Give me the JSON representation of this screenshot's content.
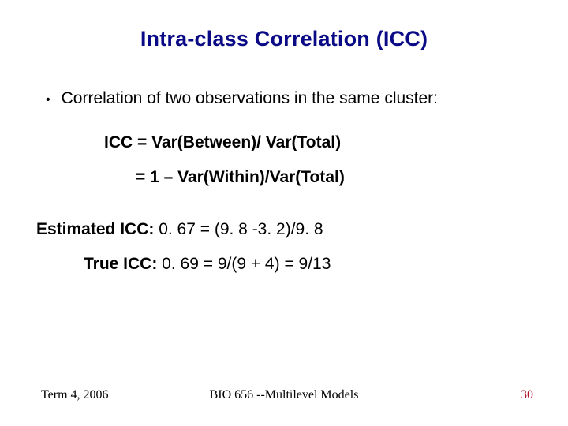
{
  "title": "Intra-class Correlation (ICC)",
  "bullet": "Correlation of two observations in the same cluster:",
  "eq1": "ICC = Var(Between)/ Var(Total)",
  "eq2": "= 1 – Var(Within)/Var(Total)",
  "line3_label": "Estimated ICC:",
  "line3_value": "  0. 67 = (9. 8 -3. 2)/9. 8",
  "line4_label": "True ICC:",
  "line4_value": "  0. 69 =  9/(9 + 4) = 9/13",
  "footer_left": "Term 4, 2006",
  "footer_center": "BIO 656 --Multilevel Models",
  "footer_right": "30"
}
